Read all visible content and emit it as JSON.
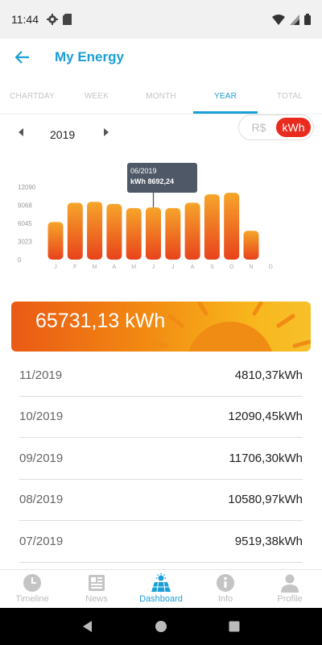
{
  "status": {
    "time": "11:44"
  },
  "header": {
    "title": "My Energy"
  },
  "tabs": [
    {
      "label": "CHARTDAY",
      "active": false
    },
    {
      "label": "WEEK",
      "active": false
    },
    {
      "label": "MONTH",
      "active": false
    },
    {
      "label": "YEAR",
      "active": true
    },
    {
      "label": "TOTAL",
      "active": false
    }
  ],
  "period": {
    "year": "2019"
  },
  "unit_toggle": {
    "rs_label": "R$",
    "kwh_label": "kWh",
    "selected": "kWh"
  },
  "chart_data": {
    "type": "bar",
    "categories": [
      "J",
      "F",
      "M",
      "A",
      "M",
      "J",
      "J",
      "A",
      "S",
      "O",
      "N",
      "D"
    ],
    "values": [
      6270,
      9470,
      9630,
      9270,
      8580,
      8692.24,
      8580,
      9470,
      10880,
      11140,
      4810.37,
      0
    ],
    "yticks": [
      "0",
      "3023",
      "6045",
      "9068",
      "12090"
    ],
    "ylim": [
      0,
      12090
    ],
    "tooltip": {
      "date": "06/2019",
      "value": "kWh 8692,24",
      "category_index": 5
    },
    "colors": {
      "bar_top": "#f6a52a",
      "bar_bottom": "#e8431c"
    }
  },
  "total": {
    "value": "65731,13 kWh"
  },
  "history": [
    {
      "date": "11/2019",
      "value": "4810,37kWh"
    },
    {
      "date": "10/2019",
      "value": "12090,45kWh"
    },
    {
      "date": "09/2019",
      "value": "11706,30kWh"
    },
    {
      "date": "08/2019",
      "value": "10580,97kWh"
    },
    {
      "date": "07/2019",
      "value": "9519,38kWh"
    }
  ],
  "bottom_nav": [
    {
      "label": "Timeline",
      "icon": "clock-icon",
      "active": false
    },
    {
      "label": "News",
      "icon": "newspaper-icon",
      "active": false
    },
    {
      "label": "Dashboard",
      "icon": "solar-panel-icon",
      "active": true
    },
    {
      "label": "Info",
      "icon": "info-icon",
      "active": false
    },
    {
      "label": "Profile",
      "icon": "user-icon",
      "active": false
    }
  ],
  "colors": {
    "accent": "#1a9fd6",
    "toggle_active": "#e82a1f"
  }
}
